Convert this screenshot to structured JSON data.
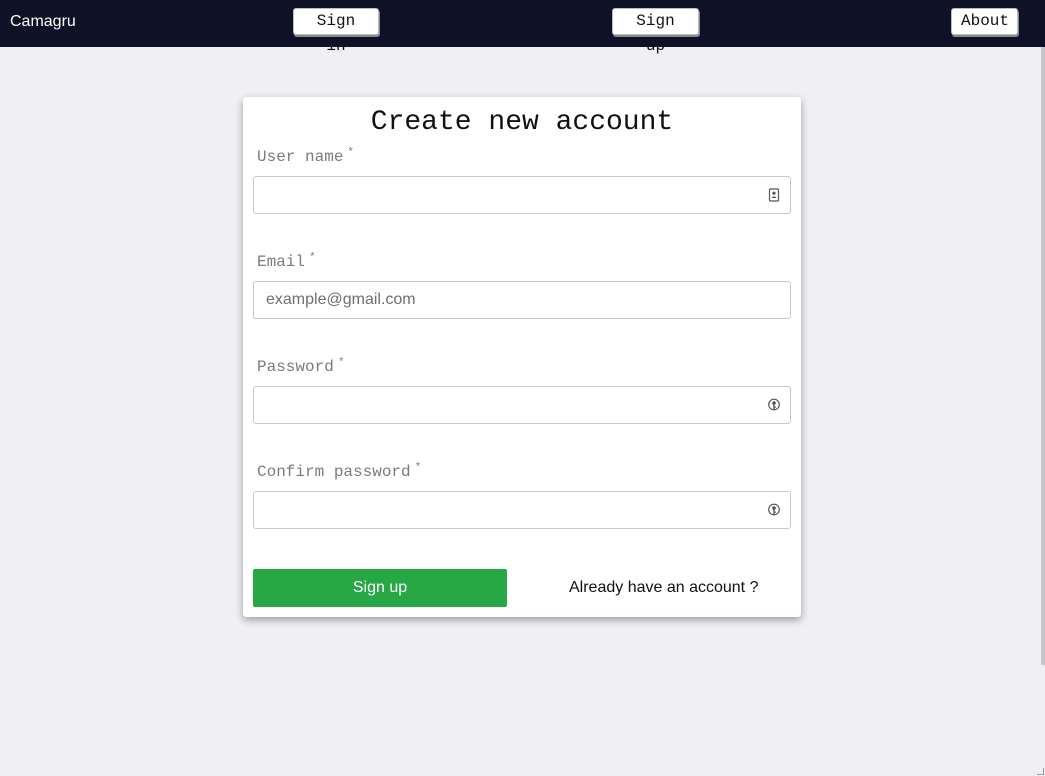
{
  "header": {
    "brand": "Camagru",
    "nav": {
      "sign_in": "Sign in",
      "sign_up": "Sign up",
      "about": "About"
    }
  },
  "form": {
    "title": "Create new account",
    "required_marker": "*",
    "fields": {
      "username": {
        "label": "User name",
        "value": "",
        "placeholder": ""
      },
      "email": {
        "label": "Email",
        "value": "",
        "placeholder": "example@gmail.com"
      },
      "password": {
        "label": "Password",
        "value": "",
        "placeholder": ""
      },
      "confirm_password": {
        "label": "Confirm password",
        "value": "",
        "placeholder": ""
      }
    },
    "submit_label": "Sign up",
    "signin_link": "Already have an account ?"
  },
  "colors": {
    "topbar": "#0f1126",
    "background": "#efeff4",
    "submit": "#28a745"
  },
  "icons": {
    "username": "contact-card-icon",
    "password": "key-icon",
    "confirm_password": "key-icon"
  }
}
